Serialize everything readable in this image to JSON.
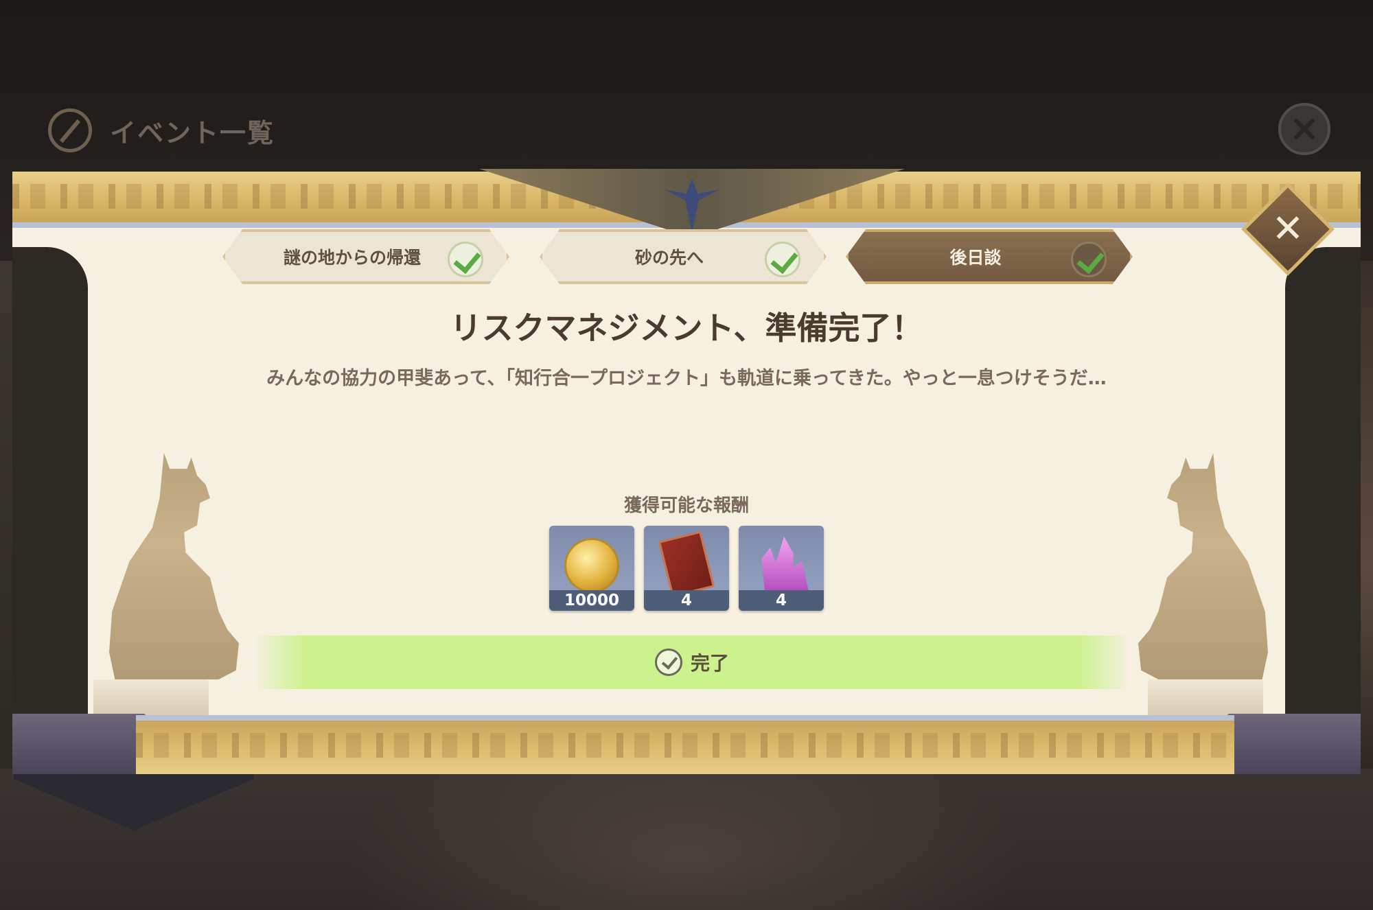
{
  "background": {
    "header_title": "イベント一覧"
  },
  "tabs": [
    {
      "label": "謎の地からの帰還",
      "completed": true,
      "active": false
    },
    {
      "label": "砂の先へ",
      "completed": true,
      "active": false
    },
    {
      "label": "後日談",
      "completed": true,
      "active": true
    }
  ],
  "dialog": {
    "title": "リスクマネジメント、準備完了！",
    "description": "みんなの協力の甲斐あって、「知行合一プロジェクト」も軌道に乗ってきた。やっと一息つけそうだ…",
    "rewards_label": "獲得可能な報酬",
    "rewards": [
      {
        "icon": "coin-icon",
        "count": "10000"
      },
      {
        "icon": "book-icon",
        "count": "4"
      },
      {
        "icon": "crystal-icon",
        "count": "4"
      }
    ],
    "complete_label": "完了"
  },
  "colors": {
    "panel": "#f6f0e1",
    "frame_gold": "#d9b767",
    "active_tab": "#7b6146",
    "complete_bar": "#ccf28e",
    "check_green": "#5bab43"
  }
}
